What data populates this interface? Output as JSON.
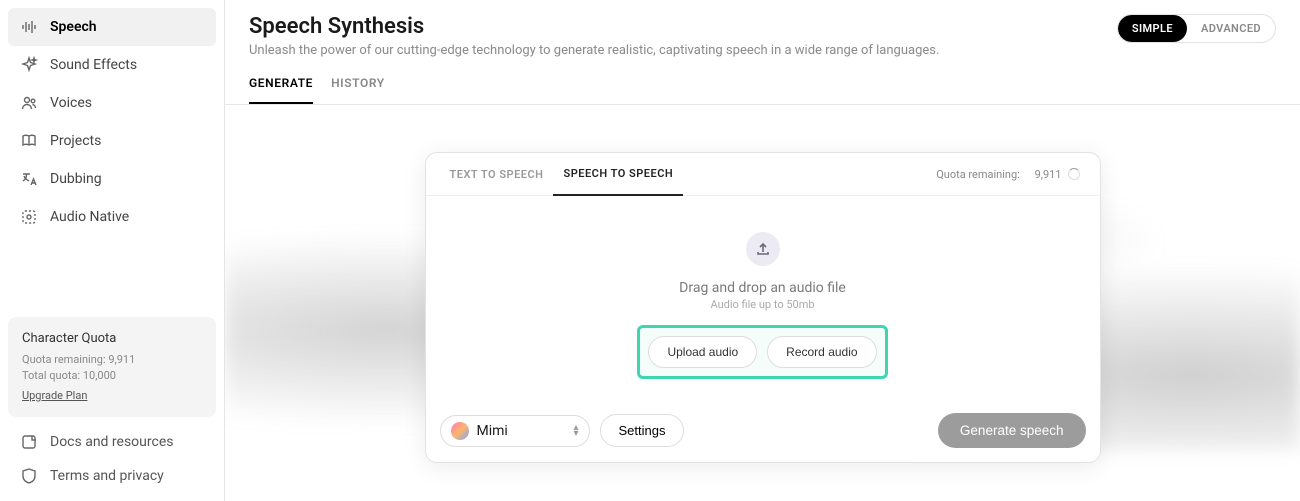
{
  "sidebar": {
    "items": [
      {
        "label": "Speech",
        "icon": "waveform-icon",
        "active": true
      },
      {
        "label": "Sound Effects",
        "icon": "sparkle-icon",
        "active": false
      },
      {
        "label": "Voices",
        "icon": "people-icon",
        "active": false
      },
      {
        "label": "Projects",
        "icon": "book-icon",
        "active": false
      },
      {
        "label": "Dubbing",
        "icon": "translate-icon",
        "active": false
      },
      {
        "label": "Audio Native",
        "icon": "embed-icon",
        "active": false
      }
    ],
    "quota": {
      "title": "Character Quota",
      "remaining_label": "Quota remaining:",
      "remaining_value": "9,911",
      "total_label": "Total quota:",
      "total_value": "10,000",
      "upgrade": "Upgrade Plan"
    },
    "footer": [
      {
        "label": "Docs and resources",
        "icon": "doc-icon"
      },
      {
        "label": "Terms and privacy",
        "icon": "shield-icon"
      }
    ]
  },
  "header": {
    "title": "Speech Synthesis",
    "subtitle": "Unleash the power of our cutting-edge technology to generate realistic, captivating speech in a wide range of languages.",
    "mode": {
      "simple": "SIMPLE",
      "advanced": "ADVANCED",
      "active": "simple"
    }
  },
  "tabs": {
    "generate": "GENERATE",
    "history": "HISTORY",
    "active": "generate"
  },
  "card": {
    "tabs": {
      "tts": "TEXT TO SPEECH",
      "sts": "SPEECH TO SPEECH",
      "active": "sts"
    },
    "quota_label": "Quota remaining:",
    "quota_value": "9,911",
    "drop_title": "Drag and drop an audio file",
    "drop_sub": "Audio file up to 50mb",
    "upload_btn": "Upload audio",
    "record_btn": "Record audio",
    "voice": "Mimi",
    "settings": "Settings",
    "generate": "Generate speech"
  }
}
